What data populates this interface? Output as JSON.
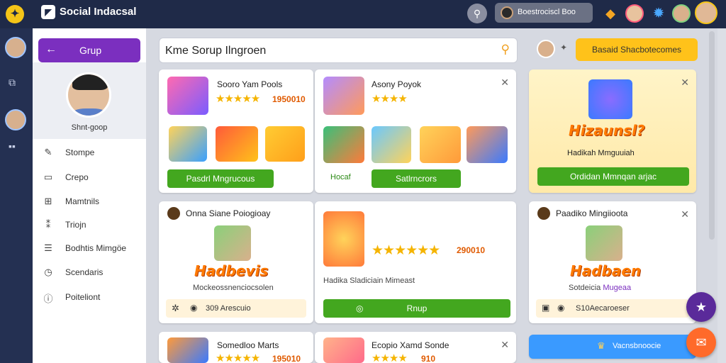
{
  "app": {
    "title": "Social Indacsal",
    "logo_icon": "compass-logo-icon"
  },
  "topbar": {
    "user_pill_text": "Boestrociscl   Boo"
  },
  "sidebar": {
    "group_button": "Grup",
    "profile_handle": "Shnt-goop",
    "items": [
      {
        "label": "Stompe",
        "icon": "pencil-icon"
      },
      {
        "label": "Crepo",
        "icon": "card-icon"
      },
      {
        "label": "Mamtnils",
        "icon": "grid-icon"
      },
      {
        "label": "Triojn",
        "icon": "settings-icon"
      },
      {
        "label": "Bodhtis Mimgöe",
        "icon": "list-icon"
      },
      {
        "label": "Scendaris",
        "icon": "clock-icon"
      },
      {
        "label": "Poiteliont",
        "icon": "info-icon"
      }
    ]
  },
  "search": {
    "value": "Kme Sorup Ilngroen"
  },
  "top_right": {
    "cta": "Basaid   Shacbotecomes"
  },
  "cards": {
    "c1": {
      "title": "Sooro Yam Pools",
      "score": "1950010",
      "button": "Pasdrl Mngrucous"
    },
    "c2": {
      "title": "Asony Poyok",
      "stage": "Hocaf",
      "button": "Satlrncrors"
    },
    "c3": {
      "cheer": "Hizaunsl?",
      "subtitle": "Hadikah Mmguuiah",
      "button": "Ordidan Mmnqan arjac"
    },
    "c4": {
      "title": "Onna Siane Poiogioay",
      "cheer": "Hadbevis",
      "subtitle": "Mockeossnenciocsolen",
      "footer": "309 Arescuio"
    },
    "c5": {
      "score": "290010",
      "subtitle": "Hadika Sladiciain Mimeast",
      "button": "Rnup"
    },
    "c6": {
      "title": "Paadiko Mingiioota",
      "cheer": "Hadbaen",
      "subtitle": "Sotdeicia",
      "subtitle_accent": "Mugeaa",
      "footer": "S10Aecaroeser"
    },
    "c7": {
      "title": "Somedloo Marts",
      "score": "195010"
    },
    "c8": {
      "title": "Ecopio Xamd Sonde",
      "score": "910"
    },
    "c9": {
      "label": "Vacnsbnoocie"
    }
  },
  "colors": {
    "accent": "#7b2fbf",
    "green": "#43a71f",
    "yellow": "#ffc21a",
    "topbar": "#1f2a48"
  }
}
